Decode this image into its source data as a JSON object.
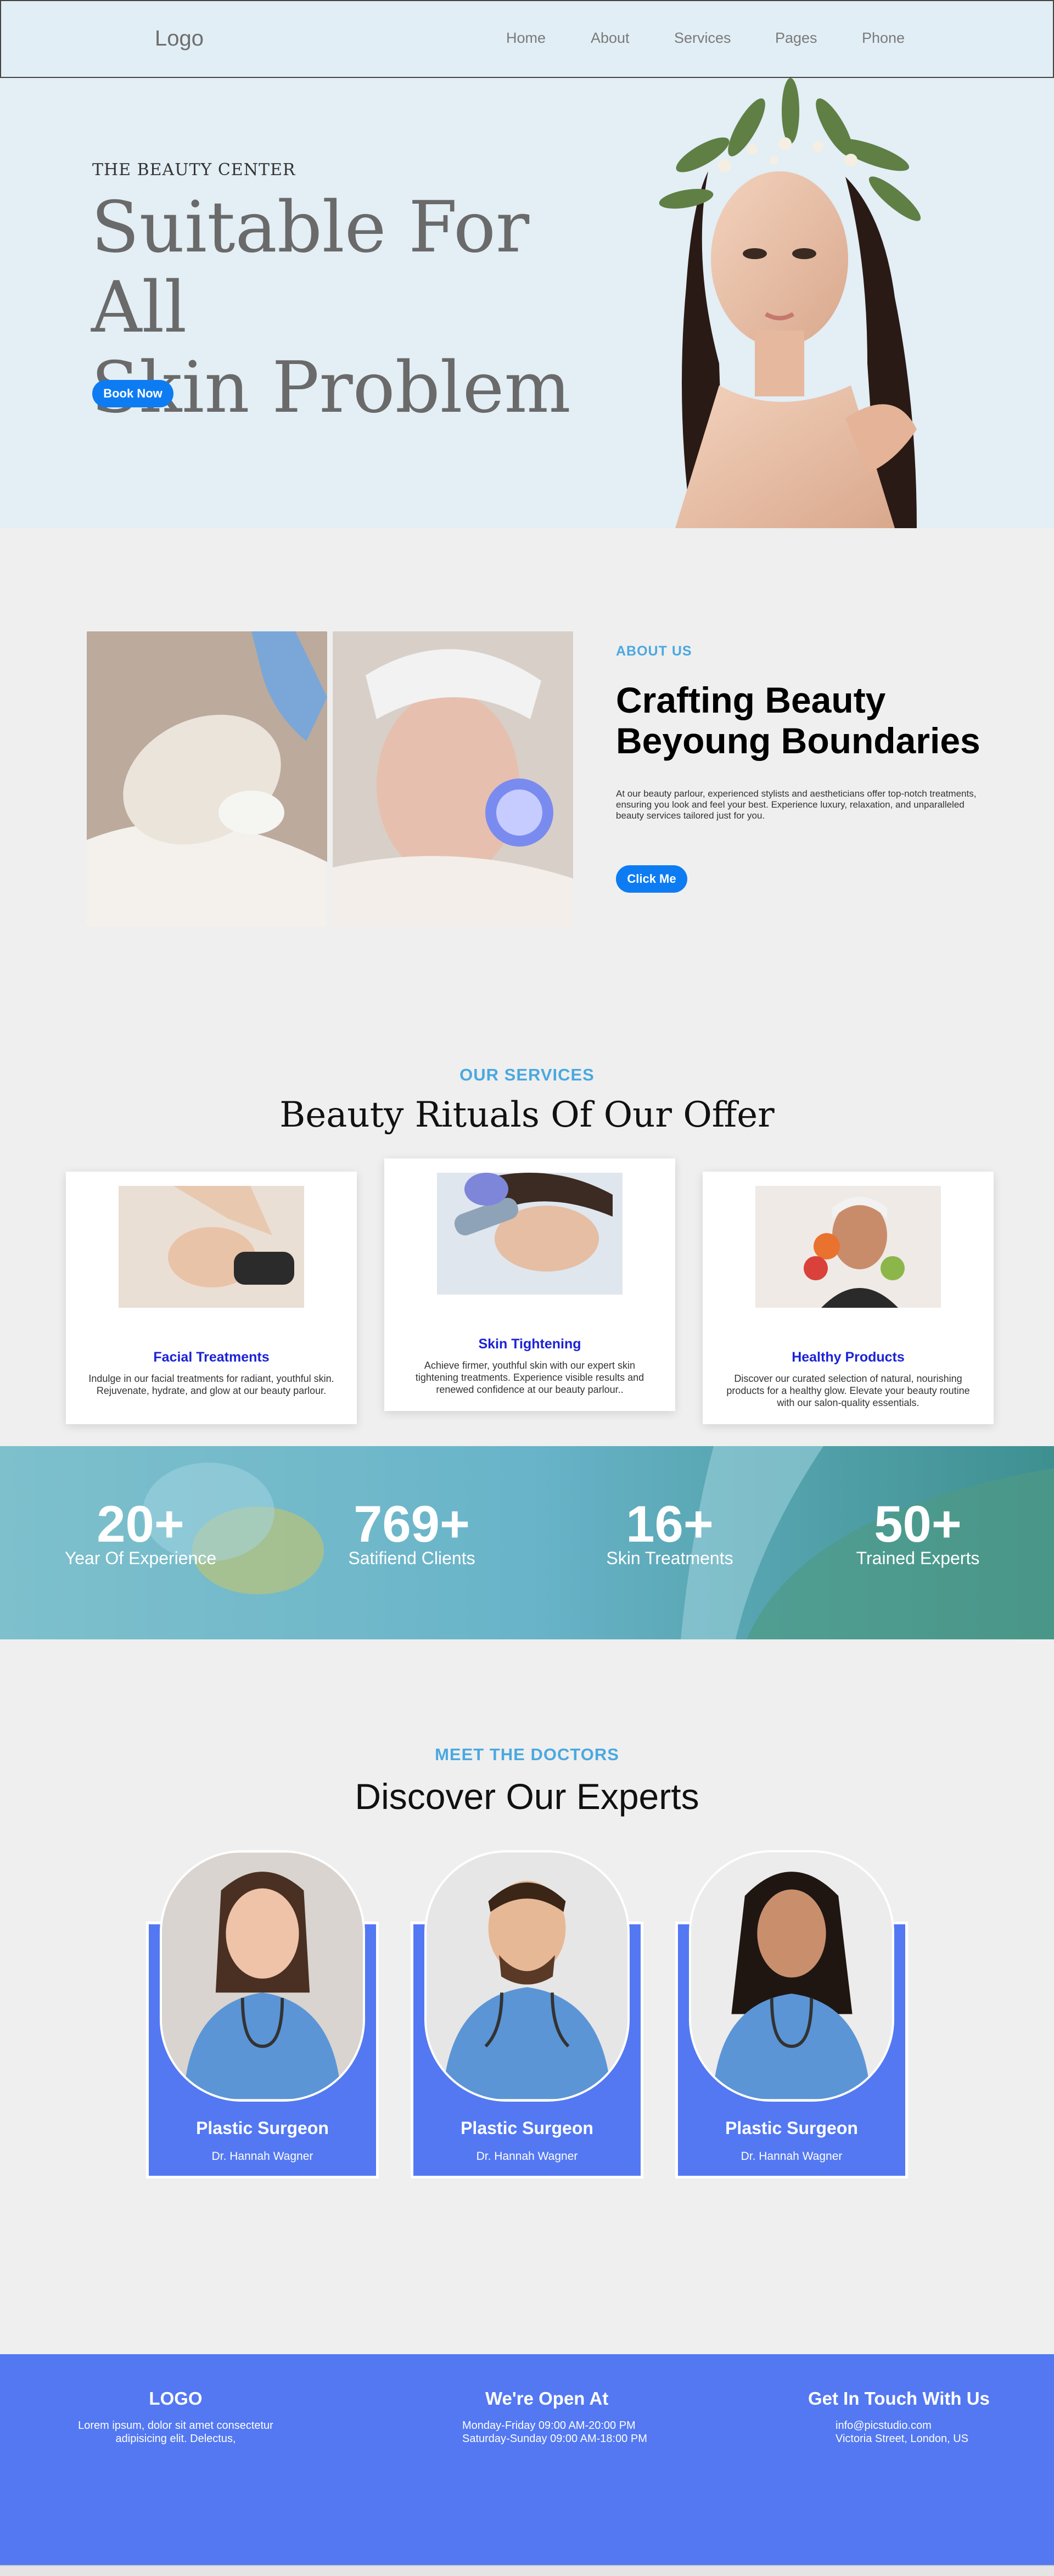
{
  "nav": {
    "logo": "Logo",
    "items": [
      "Home",
      "About",
      "Services",
      "Pages",
      "Phone"
    ]
  },
  "hero": {
    "eyebrow": "THE BEAUTY CENTER",
    "title_line1": "Suitable For All",
    "title_line2": "Skin Problem",
    "button": "Book Now"
  },
  "about": {
    "eyebrow": "ABOUT US",
    "title_line1": "Crafting Beauty",
    "title_line2": "Beyoung Boundaries",
    "text": "At our beauty parlour, experienced stylists and aestheticians offer top-notch treatments, ensuring you look and feel your best. Experience luxury, relaxation, and unparalleled beauty services tailored just for you.",
    "button": "Click Me"
  },
  "services": {
    "eyebrow": "OUR SERVICES",
    "title": "Beauty Rituals Of Our Offer",
    "cards": [
      {
        "title": "Facial Treatments",
        "desc": "Indulge in our facial treatments for radiant, youthful skin. Rejuvenate, hydrate, and glow at our beauty parlour."
      },
      {
        "title": "Skin Tightening",
        "desc": "Achieve firmer, youthful skin with our expert skin tightening treatments. Experience visible results and renewed confidence at our beauty parlour.."
      },
      {
        "title": "Healthy Products",
        "desc": "Discover our curated selection of natural, nourishing products for a healthy glow. Elevate your beauty routine with our salon-quality essentials."
      }
    ]
  },
  "stats": [
    {
      "num": "20+",
      "label": "Year Of Experience"
    },
    {
      "num": "769+",
      "label": "Satifiend Clients"
    },
    {
      "num": "16+",
      "label": "Skin Treatments"
    },
    {
      "num": "50+",
      "label": "Trained Experts"
    }
  ],
  "doctors": {
    "eyebrow": "MEET THE DOCTORS",
    "title": "Discover Our Experts",
    "cards": [
      {
        "role": "Plastic Surgeon",
        "name": "Dr. Hannah Wagner"
      },
      {
        "role": "Plastic Surgeon",
        "name": "Dr. Hannah Wagner"
      },
      {
        "role": "Plastic Surgeon",
        "name": "Dr. Hannah Wagner"
      }
    ]
  },
  "footer": {
    "col1": {
      "head": "LOGO",
      "line1": "Lorem ipsum, dolor sit amet consectetur",
      "line2": "adipisicing elit. Delectus,"
    },
    "col2": {
      "head": "We're Open At",
      "line1": "Monday-Friday 09:00 AM-20:00 PM",
      "line2": "Saturday-Sunday 09:00 AM-18:00 PM"
    },
    "col3": {
      "head": "Get In Touch With Us",
      "line1": "info@picstudio.com",
      "line2": "Victoria Street, London, US"
    }
  },
  "colors": {
    "accent": "#0d7cf2",
    "eyebrow": "#4aa8e0",
    "panel_blue": "#5378f2",
    "service_title": "#1b22d8"
  }
}
